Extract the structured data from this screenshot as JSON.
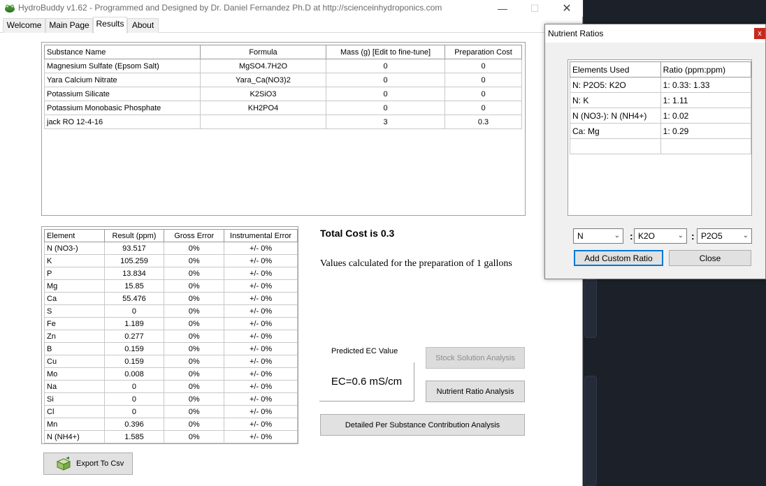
{
  "window": {
    "title": "HydroBuddy v1.62 - Programmed and Designed by Dr. Daniel Fernandez Ph.D at http://scienceinhydroponics.com",
    "minimize": "—",
    "maximize": "☐",
    "close": "✕"
  },
  "tabs": [
    "Welcome",
    "Main Page",
    "Results",
    "About"
  ],
  "substances": {
    "headers": [
      "Substance Name",
      "Formula",
      "Mass (g) [Edit to fine-tune]",
      "Preparation Cost"
    ],
    "rows": [
      [
        "Magnesium Sulfate (Epsom Salt)",
        "MgSO4.7H2O",
        "0",
        "0"
      ],
      [
        "Yara Calcium Nitrate",
        "Yara_Ca(NO3)2",
        "0",
        "0"
      ],
      [
        "Potassium Silicate",
        "K2SiO3",
        "0",
        "0"
      ],
      [
        "Potassium Monobasic Phosphate",
        "KH2PO4",
        "0",
        "0"
      ],
      [
        "jack RO 12-4-16",
        "",
        "3",
        "0.3"
      ]
    ]
  },
  "elements": {
    "headers": [
      "Element",
      "Result (ppm)",
      "Gross Error",
      "Instrumental Error"
    ],
    "rows": [
      [
        "N (NO3-)",
        "93.517",
        "0%",
        "+/- 0%"
      ],
      [
        "K",
        "105.259",
        "0%",
        "+/- 0%"
      ],
      [
        "P",
        "13.834",
        "0%",
        "+/- 0%"
      ],
      [
        "Mg",
        "15.85",
        "0%",
        "+/- 0%"
      ],
      [
        "Ca",
        "55.476",
        "0%",
        "+/- 0%"
      ],
      [
        "S",
        "0",
        "0%",
        "+/- 0%"
      ],
      [
        "Fe",
        "1.189",
        "0%",
        "+/- 0%"
      ],
      [
        "Zn",
        "0.277",
        "0%",
        "+/- 0%"
      ],
      [
        "B",
        "0.159",
        "0%",
        "+/- 0%"
      ],
      [
        "Cu",
        "0.159",
        "0%",
        "+/- 0%"
      ],
      [
        "Mo",
        "0.008",
        "0%",
        "+/- 0%"
      ],
      [
        "Na",
        "0",
        "0%",
        "+/- 0%"
      ],
      [
        "Si",
        "0",
        "0%",
        "+/- 0%"
      ],
      [
        "Cl",
        "0",
        "0%",
        "+/- 0%"
      ],
      [
        "Mn",
        "0.396",
        "0%",
        "+/- 0%"
      ],
      [
        "N (NH4+)",
        "1.585",
        "0%",
        "+/- 0%"
      ]
    ]
  },
  "summary": {
    "total_cost": "Total Cost is 0.3",
    "calc_note": "Values calculated for the preparation of 1 gallons",
    "ec_label": "Predicted EC Value",
    "ec_value": "EC=0.6 mS/cm"
  },
  "buttons": {
    "export": "Export To Csv",
    "stock_solution": "Stock Solution Analysis",
    "nutrient_ratio": "Nutrient Ratio Analysis",
    "detailed": "Detailed Per Substance Contribution Analysis"
  },
  "ratio_dialog": {
    "title": "Nutrient Ratios",
    "close_x": "x",
    "headers": [
      "Elements Used",
      "Ratio (ppm:ppm)"
    ],
    "rows": [
      [
        "N: P2O5: K2O",
        "1: 0.33: 1.33"
      ],
      [
        "N: K",
        "1: 1.11"
      ],
      [
        "N (NO3-): N (NH4+)",
        "1: 0.02"
      ],
      [
        "Ca: Mg",
        "1: 0.29"
      ],
      [
        "",
        ""
      ]
    ],
    "select1": "N",
    "select2": "K2O",
    "select3": "P2O5",
    "colon": ":",
    "add_button": "Add Custom Ratio",
    "close_button": "Close"
  },
  "icons": {
    "app": "frog-icon",
    "export": "box-export-icon",
    "dropdown": "chevron-down-icon"
  }
}
